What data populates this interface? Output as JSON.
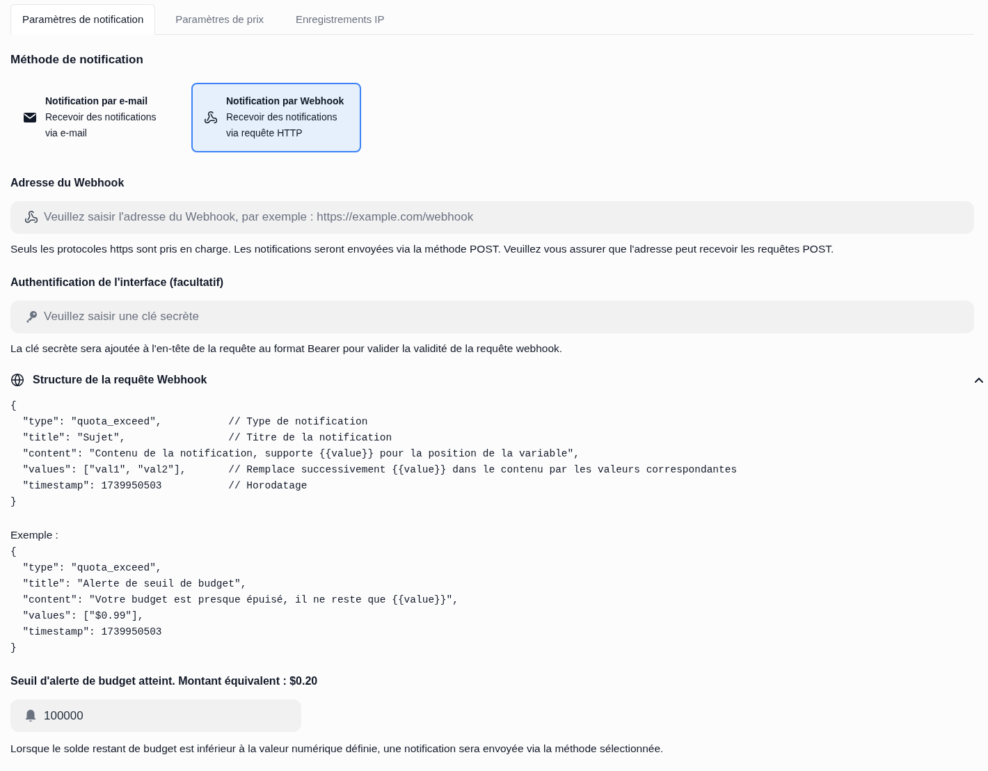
{
  "tabs": [
    {
      "label": "Paramètres de notification",
      "selected": true
    },
    {
      "label": "Paramètres de prix",
      "selected": false
    },
    {
      "label": "Enregistrements IP",
      "selected": false
    }
  ],
  "method": {
    "title": "Méthode de notification",
    "options": [
      {
        "kind": "email",
        "title": "Notification par e-mail",
        "description": "Recevoir des notifications via e-mail",
        "selected": false
      },
      {
        "kind": "webhook",
        "title": "Notification par Webhook",
        "description": "Recevoir des notifications via requête HTTP",
        "selected": true
      }
    ]
  },
  "webhook_address": {
    "label": "Adresse du Webhook",
    "placeholder": "Veuillez saisir l'adresse du Webhook, par exemple : https://example.com/webhook",
    "help": "Seuls les protocoles https sont pris en charge. Les notifications seront envoyées via la méthode POST. Veuillez vous assurer que l'adresse peut recevoir les requêtes POST."
  },
  "auth": {
    "label": "Authentification de l'interface (facultatif)",
    "placeholder": "Veuillez saisir une clé secrète",
    "help": "La clé secrète sera ajoutée à l'en-tête de la requête au format Bearer pour valider la validité de la requête webhook."
  },
  "structure": {
    "title": "Structure de la requête Webhook",
    "expanded": true,
    "code": [
      "{",
      "  \"type\": \"quota_exceed\",           // Type de notification",
      "  \"title\": \"Sujet\",                 // Titre de la notification",
      "  \"content\": \"Contenu de la notification, supporte {{value}} pour la position de la variable\",",
      "  \"values\": [\"val1\", \"val2\"],       // Remplace successivement {{value}} dans le contenu par les valeurs correspondantes",
      "  \"timestamp\": 1739950503           // Horodatage",
      "}"
    ],
    "example_label": "Exemple :",
    "example_code": [
      "{",
      "  \"type\": \"quota_exceed\",",
      "  \"title\": \"Alerte de seuil de budget\",",
      "  \"content\": \"Votre budget est presque épuisé, il ne reste que {{value}}\",",
      "  \"values\": [\"$0.99\"],",
      "  \"timestamp\": 1739950503",
      "}"
    ]
  },
  "threshold": {
    "label": "Seuil d'alerte de budget atteint. Montant équivalent : $0.20",
    "value": "100000",
    "help": "Lorsque le solde restant de budget est inférieur à la valeur numérique définie, une notification sera envoyée via la méthode sélectionnée."
  }
}
